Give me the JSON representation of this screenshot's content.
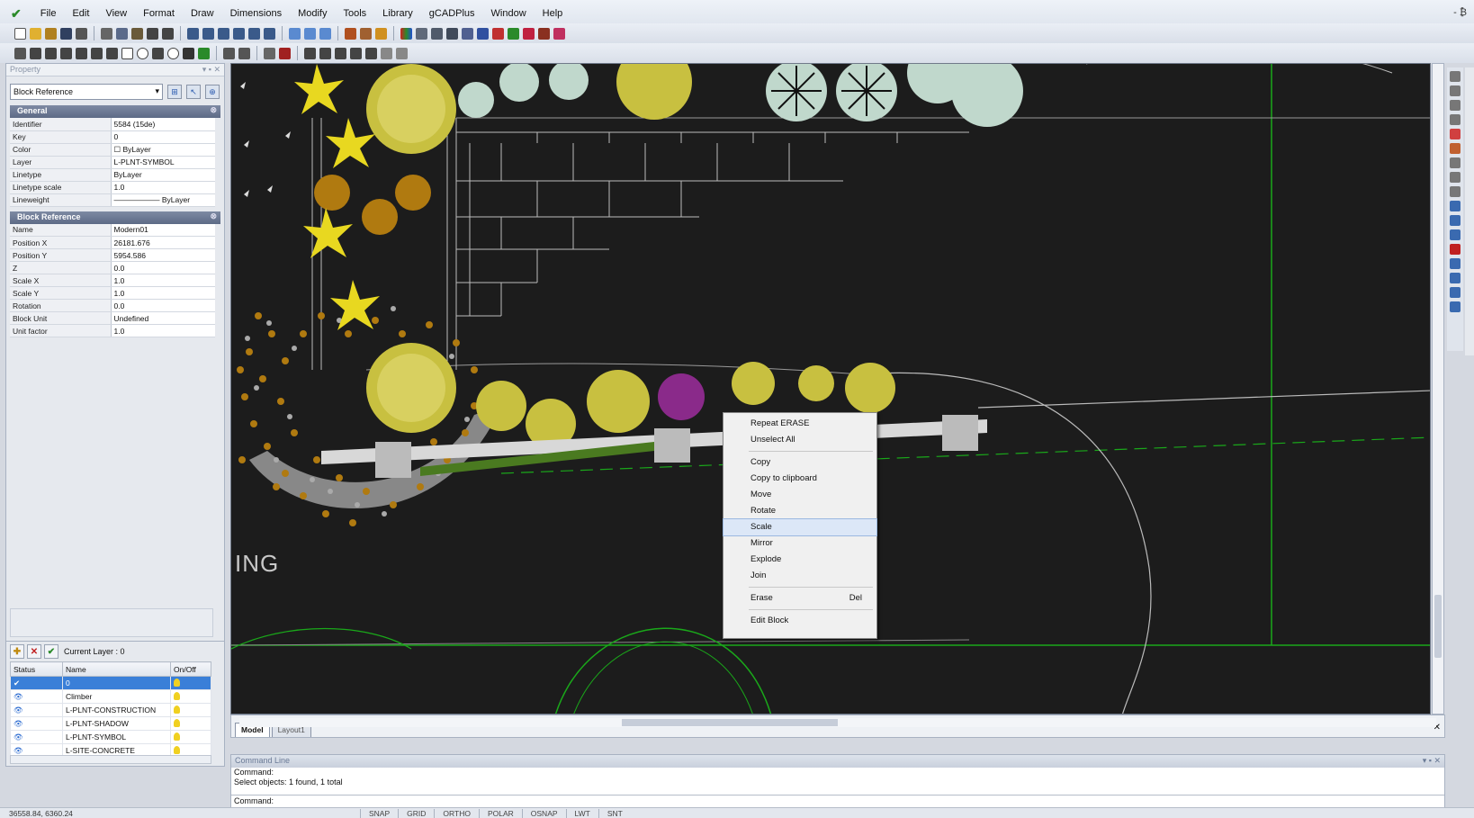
{
  "menu": {
    "items": [
      "File",
      "Edit",
      "View",
      "Format",
      "Draw",
      "Dimensions",
      "Modify",
      "Tools",
      "Library",
      "gCADPlus",
      "Window",
      "Help"
    ],
    "window_controls": "- ₿"
  },
  "property_panel": {
    "title": "Property",
    "title_controls": "▾ ▪ ✕",
    "block_select_value": "Block Reference",
    "general_header": "General",
    "general": [
      {
        "key": "Identifier",
        "value": "5584 (15de)"
      },
      {
        "key": "Key",
        "value": "0"
      },
      {
        "key": "Color",
        "value": "☐ ByLayer"
      },
      {
        "key": "Layer",
        "value": "L-PLNT-SYMBOL"
      },
      {
        "key": "Linetype",
        "value": "ByLayer"
      },
      {
        "key": "Linetype scale",
        "value": "1.0"
      },
      {
        "key": "Lineweight",
        "value": "——————  ByLayer"
      }
    ],
    "block_header": "Block Reference",
    "block": [
      {
        "key": "Name",
        "value": "Modern01"
      },
      {
        "key": "Position X",
        "value": "26181.676"
      },
      {
        "key": "Position Y",
        "value": "5954.586"
      },
      {
        "key": "Z",
        "value": "0.0"
      },
      {
        "key": "Scale X",
        "value": "1.0"
      },
      {
        "key": "Scale Y",
        "value": "1.0"
      },
      {
        "key": "Rotation",
        "value": "0.0"
      },
      {
        "key": "Block Unit",
        "value": "Undefined"
      },
      {
        "key": "Unit factor",
        "value": "1.0"
      }
    ]
  },
  "layer_panel": {
    "current_layer": "Current Layer : 0",
    "columns": [
      "Status",
      "Name",
      "On/Off"
    ],
    "rows": [
      {
        "status": "✔",
        "name": "0"
      },
      {
        "status": "👁",
        "name": "Climber"
      },
      {
        "status": "👁",
        "name": "L-PLNT-CONSTRUCTION"
      },
      {
        "status": "👁",
        "name": "L-PLNT-SHADOW"
      },
      {
        "status": "👁",
        "name": "L-PLNT-SYMBOL"
      },
      {
        "status": "👁",
        "name": "L-SITE-CONCRETE"
      }
    ]
  },
  "drawing": {
    "partial_label": "ING"
  },
  "context_menu": {
    "items": [
      {
        "label": "Repeat ERASE"
      },
      {
        "label": "Unselect All"
      },
      {
        "sep": true
      },
      {
        "label": "Copy"
      },
      {
        "label": "Copy to clipboard"
      },
      {
        "label": "Move"
      },
      {
        "label": "Rotate"
      },
      {
        "label": "Scale",
        "highlighted": true
      },
      {
        "label": "Mirror"
      },
      {
        "label": "Explode"
      },
      {
        "label": "Join"
      },
      {
        "sep": true
      },
      {
        "label": "Erase",
        "shortcut": "Del"
      },
      {
        "sep": true
      },
      {
        "label": "Edit Block"
      }
    ]
  },
  "tabs": {
    "items": [
      "Model",
      "Layout1"
    ],
    "active": "Model",
    "close": "✕"
  },
  "command_line": {
    "title": "Command Line",
    "title_controls": "▾ ▪ ✕",
    "history": [
      "Command:",
      "Select objects: 1 found,  1 total"
    ],
    "prompt": "Command:"
  },
  "status_bar": {
    "coordinates": "36558.84,  6360.24",
    "toggles": [
      "SNAP",
      "GRID",
      "ORTHO",
      "POLAR",
      "OSNAP",
      "LWT",
      "SNT"
    ]
  },
  "colors": {
    "canvas": "#1c1c1c",
    "accent": "#3a7fd8",
    "plant_yellow": "#e8d820",
    "plant_olive": "#c8c040",
    "plant_brown": "#b07a10",
    "guide_green": "#1aa81a"
  }
}
